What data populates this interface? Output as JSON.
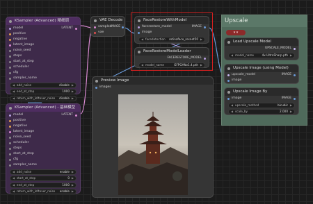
{
  "colors": {
    "canvas": "#1b1b1b",
    "node_purple": "#3e2a4a",
    "node_dark": "#353535",
    "group_green": "#4f6a5b",
    "highlight_red": "#d02020",
    "link_latent": "#d98ad2",
    "link_image": "#6a9ad8",
    "link_model": "#b8a0e0",
    "link_upscale": "#c8b8f0"
  },
  "ksampler1": {
    "title": "KSampler (Advanced) 精细调",
    "out": "LATENT",
    "inputs": [
      "model",
      "positive",
      "negative",
      "latent_image",
      "noise_seed",
      "steps",
      "start_at_step",
      "scheduler",
      "cfg",
      "sampler_name"
    ],
    "widgets": [
      {
        "label": "add_noise",
        "value": "disable"
      },
      {
        "label": "end_at_step",
        "value": "1000"
      },
      {
        "label": "return_with_leftover_noise",
        "value": "disable"
      }
    ]
  },
  "ksampler2": {
    "title": "KSampler (Advanced) - 基础模型",
    "out": "LATENT",
    "inputs": [
      "model",
      "positive",
      "negative",
      "latent_image",
      "noise_seed",
      "scheduler",
      "steps",
      "start_at_step",
      "cfg",
      "sampler_name"
    ],
    "widgets": [
      {
        "label": "add_noise",
        "value": "enable"
      },
      {
        "label": "start_at_step",
        "value": "0"
      },
      {
        "label": "end_at_step",
        "value": "1000"
      },
      {
        "label": "return_with_leftover_noise",
        "value": "enable"
      }
    ]
  },
  "vae": {
    "title": "VAE Decode",
    "inputs": [
      "samples",
      "vae"
    ],
    "out": "IMAGE"
  },
  "face": {
    "title": "FaceRestoreWithModel",
    "inputs": [
      "facerestore_model",
      "image"
    ],
    "out": "IMAGE",
    "widgets": [
      {
        "label": "facedetection",
        "value": "retinaface_resnet50"
      }
    ]
  },
  "faceloader": {
    "title": "FaceRestoreModelLoader",
    "out": "FACERESTORE_MODEL",
    "widgets": [
      {
        "label": "model_name",
        "value": "GFPGANv1.4.pth"
      }
    ]
  },
  "preview": {
    "title": "Preview Image",
    "input": "images"
  },
  "group": {
    "title": "Upscale",
    "badge": "▾  ▾"
  },
  "upload": {
    "title": "Load Upscale Model",
    "out": "UPSCALE_MODEL",
    "widgets": [
      {
        "label": "model_name",
        "value": "4x-UltraSharp.pth"
      }
    ]
  },
  "upimg": {
    "title": "Upscale Image (using Model)",
    "inputs": [
      "upscale_model",
      "image"
    ],
    "out": "IMAGE"
  },
  "upby": {
    "title": "Upscale Image By",
    "inputs": [
      "image"
    ],
    "out": "IMAGE",
    "widgets": [
      {
        "label": "upscale_method",
        "value": "bicubic"
      },
      {
        "label": "scale_by",
        "value": "2.000"
      }
    ]
  }
}
